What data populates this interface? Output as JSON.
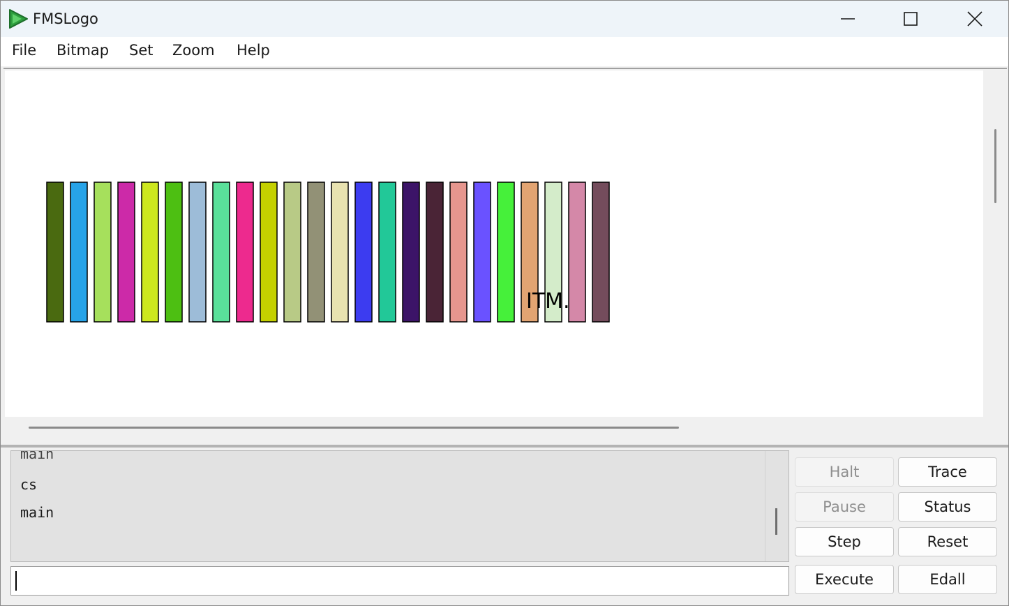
{
  "window": {
    "title": "FMSLogo"
  },
  "menu": [
    "File",
    "Bitmap",
    "Set",
    "Zoom",
    "Help"
  ],
  "canvas": {
    "bar_colors": [
      "#4a6a10",
      "#27a3e8",
      "#a6e05c",
      "#cc2aa8",
      "#cde81e",
      "#4dbf12",
      "#9dbcd8",
      "#5ae09a",
      "#ed2a8e",
      "#c4d000",
      "#b8ca86",
      "#929176",
      "#e8e2b0",
      "#3c3cf0",
      "#22c898",
      "#3c1468",
      "#4a2436",
      "#e6968e",
      "#6a52ff",
      "#46f03a",
      "#e2a472",
      "#d4ecca",
      "#d488a8",
      "#744c5c"
    ],
    "label": "ITM."
  },
  "output": {
    "lines": [
      "main",
      "cs",
      "main"
    ]
  },
  "input": {
    "value": ""
  },
  "buttons": {
    "halt": "Halt",
    "trace": "Trace",
    "pause": "Pause",
    "status": "Status",
    "step": "Step",
    "reset": "Reset",
    "execute": "Execute",
    "edall": "Edall"
  }
}
